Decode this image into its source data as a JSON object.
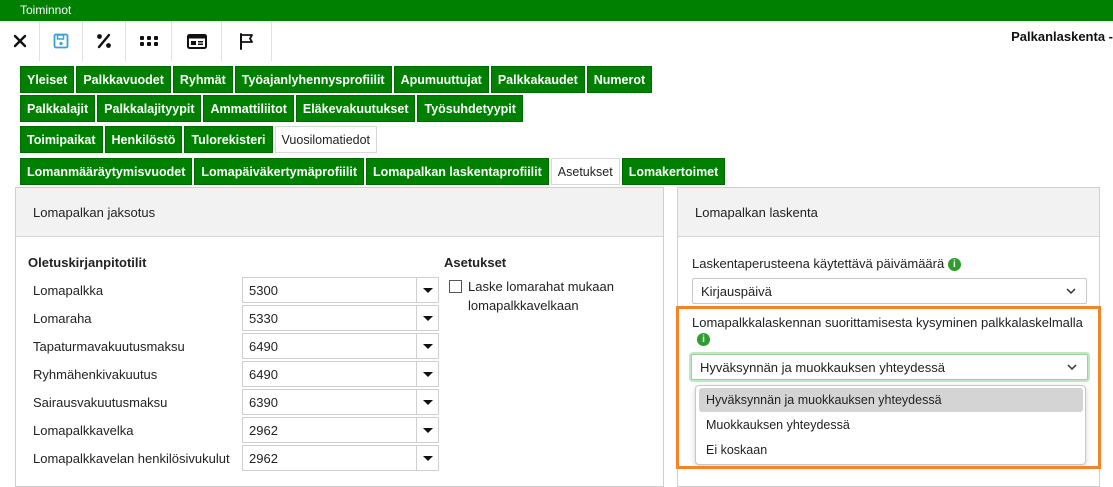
{
  "window": {
    "menu_title": "Toiminnot",
    "app_title": "Palkanlaskenta -"
  },
  "toolbar": [
    {
      "name": "close-icon"
    },
    {
      "name": "save-icon"
    },
    {
      "name": "percent-icon"
    },
    {
      "name": "apps-icon"
    },
    {
      "name": "id-card-icon"
    },
    {
      "name": "flag-icon"
    }
  ],
  "tabs": {
    "row1": [
      "Yleiset",
      "Palkkavuodet",
      "Ryhmät",
      "Työajanlyhennysprofiilit",
      "Apumuuttujat",
      "Palkkakaudet",
      "Numerot"
    ],
    "row2": [
      "Palkkalajit",
      "Palkkalajityypit",
      "Ammattiliitot",
      "Eläkevakuutukset",
      "Työsuhdetyypit"
    ],
    "row3": [
      "Toimipaikat",
      "Henkilöstö",
      "Tulorekisteri",
      "Vuosilomatiedot"
    ],
    "row4": [
      "Lomanmääräytymisvuodet",
      "Lomapäiväkertymäprofiilit",
      "Lomapalkan laskentaprofiilit",
      "Asetukset",
      "Lomakertoimet"
    ]
  },
  "left_panel": {
    "title": "Lomapalkan jaksotus",
    "accounts_heading": "Oletuskirjanpitotilit",
    "accounts": [
      {
        "label": "Lomapalkka",
        "value": "5300"
      },
      {
        "label": "Lomaraha",
        "value": "5330"
      },
      {
        "label": "Tapaturmavakuutusmaksu",
        "value": "6490"
      },
      {
        "label": "Ryhmähenkivakuutus",
        "value": "6490"
      },
      {
        "label": "Sairausvakuutusmaksu",
        "value": "6390"
      },
      {
        "label": "Lomapalkkavelka",
        "value": "2962"
      },
      {
        "label": "Lomapalkkavelan henkilösivukulut",
        "value": "2962"
      }
    ],
    "settings_heading": "Asetukset",
    "checkbox_label_line1": "Laske lomarahat mukaan",
    "checkbox_label_line2": "lomapalkkavelkaan",
    "checkbox_checked": false
  },
  "right_panel": {
    "title": "Lomapalkan laskenta",
    "date_label": "Laskentaperusteena käytettävä päivämäärä",
    "date_value": "Kirjauspäivä",
    "query_label": "Lomapalkkalaskennan suorittamisesta kysyminen palkkalaskelmalla",
    "query_value": "Hyväksynnän ja muokkauksen yhteydessä",
    "query_options": [
      "Hyväksynnän ja muokkauksen yhteydessä",
      "Muokkauksen yhteydessä",
      "Ei koskaan"
    ],
    "info_glyph": "i"
  },
  "colors": {
    "brand_green": "#008000",
    "highlight_orange": "#f58426",
    "info_green": "#2e9d2e"
  }
}
